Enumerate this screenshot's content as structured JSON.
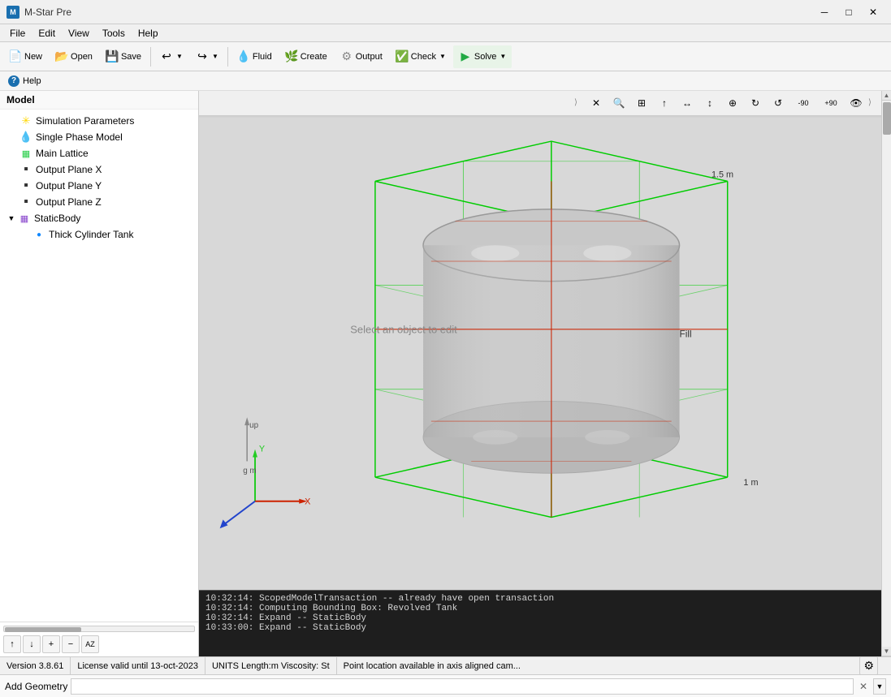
{
  "app": {
    "title": "M-Star Pre",
    "icon_text": "M"
  },
  "titlebar": {
    "minimize": "─",
    "maximize": "□",
    "close": "✕"
  },
  "menu": {
    "items": [
      "File",
      "Edit",
      "View",
      "Tools",
      "Help"
    ]
  },
  "toolbar": {
    "buttons": [
      {
        "id": "new",
        "label": "New",
        "icon": "📄"
      },
      {
        "id": "open",
        "label": "Open",
        "icon": "📂"
      },
      {
        "id": "save",
        "label": "Save",
        "icon": "💾"
      },
      {
        "id": "redo-dropdown",
        "label": "",
        "icon": "↩",
        "has_dropdown": true
      },
      {
        "id": "undo-dropdown",
        "label": "",
        "icon": "↪",
        "has_dropdown": true
      },
      {
        "id": "fluid",
        "label": "Fluid",
        "icon": "💧"
      },
      {
        "id": "create",
        "label": "Create",
        "icon": "🌿"
      },
      {
        "id": "output",
        "label": "Output",
        "icon": "⚙"
      },
      {
        "id": "check",
        "label": "Check",
        "icon": "✅",
        "has_dropdown": true
      },
      {
        "id": "solve",
        "label": "Solve",
        "icon": "▶",
        "has_dropdown": true
      }
    ]
  },
  "help_bar": {
    "label": "Help"
  },
  "sidebar": {
    "header": "Model",
    "tree": [
      {
        "id": "sim-params",
        "label": "Simulation Parameters",
        "icon": "✳",
        "icon_color": "#ffd700",
        "indent": 1,
        "has_expand": false
      },
      {
        "id": "single-phase",
        "label": "Single Phase Model",
        "icon": "💧",
        "icon_color": "#4488ff",
        "indent": 1,
        "has_expand": false
      },
      {
        "id": "main-lattice",
        "label": "Main Lattice",
        "icon": "🟫",
        "icon_color": "#22cc44",
        "indent": 1,
        "has_expand": false
      },
      {
        "id": "output-x",
        "label": "Output Plane X",
        "icon": "▪",
        "icon_color": "#333",
        "indent": 1,
        "has_expand": false
      },
      {
        "id": "output-y",
        "label": "Output Plane Y",
        "icon": "▪",
        "icon_color": "#333",
        "indent": 1,
        "has_expand": false
      },
      {
        "id": "output-z",
        "label": "Output Plane Z",
        "icon": "▪",
        "icon_color": "#333",
        "indent": 1,
        "has_expand": false
      },
      {
        "id": "static-body",
        "label": "StaticBody",
        "icon": "▦",
        "icon_color": "#8844cc",
        "indent": 0,
        "has_expand": true,
        "expanded": true
      },
      {
        "id": "thick-cylinder",
        "label": "Thick Cylinder Tank",
        "icon": "●",
        "icon_color": "#1188ff",
        "indent": 2,
        "has_expand": false
      }
    ],
    "scroll_buttons": [
      "↑",
      "↓",
      "+",
      "−",
      "AZ"
    ]
  },
  "viewport": {
    "toolbar_icons": [
      "✕",
      "🔍",
      "⊞",
      "↑",
      "↔",
      "↕",
      "⊕",
      "↻",
      "↺",
      "-90",
      "+90",
      "👁"
    ],
    "scene_hint": "Select an object to edit",
    "label_15m": "1.5 m",
    "label_1m": "1 m",
    "fill_label": "Fill",
    "axis_labels": {
      "y": "Y",
      "x": "X",
      "up": "up",
      "g_m": "g m"
    }
  },
  "log": {
    "lines": [
      "10:32:14: ScopedModelTransaction -- already have open transaction",
      "10:32:14: Computing Bounding Box: Revolved Tank",
      "10:32:14: Expand -- StaticBody",
      "10:33:00: Expand -- StaticBody"
    ]
  },
  "status_bar": {
    "version": "Version 3.8.61",
    "license": "License valid until 13-oct-2023",
    "units": "UNITS Length:m  Viscosity: St",
    "point_location": "Point location available in axis aligned cam..."
  },
  "add_geometry": {
    "label": "Add Geometry",
    "placeholder": ""
  }
}
